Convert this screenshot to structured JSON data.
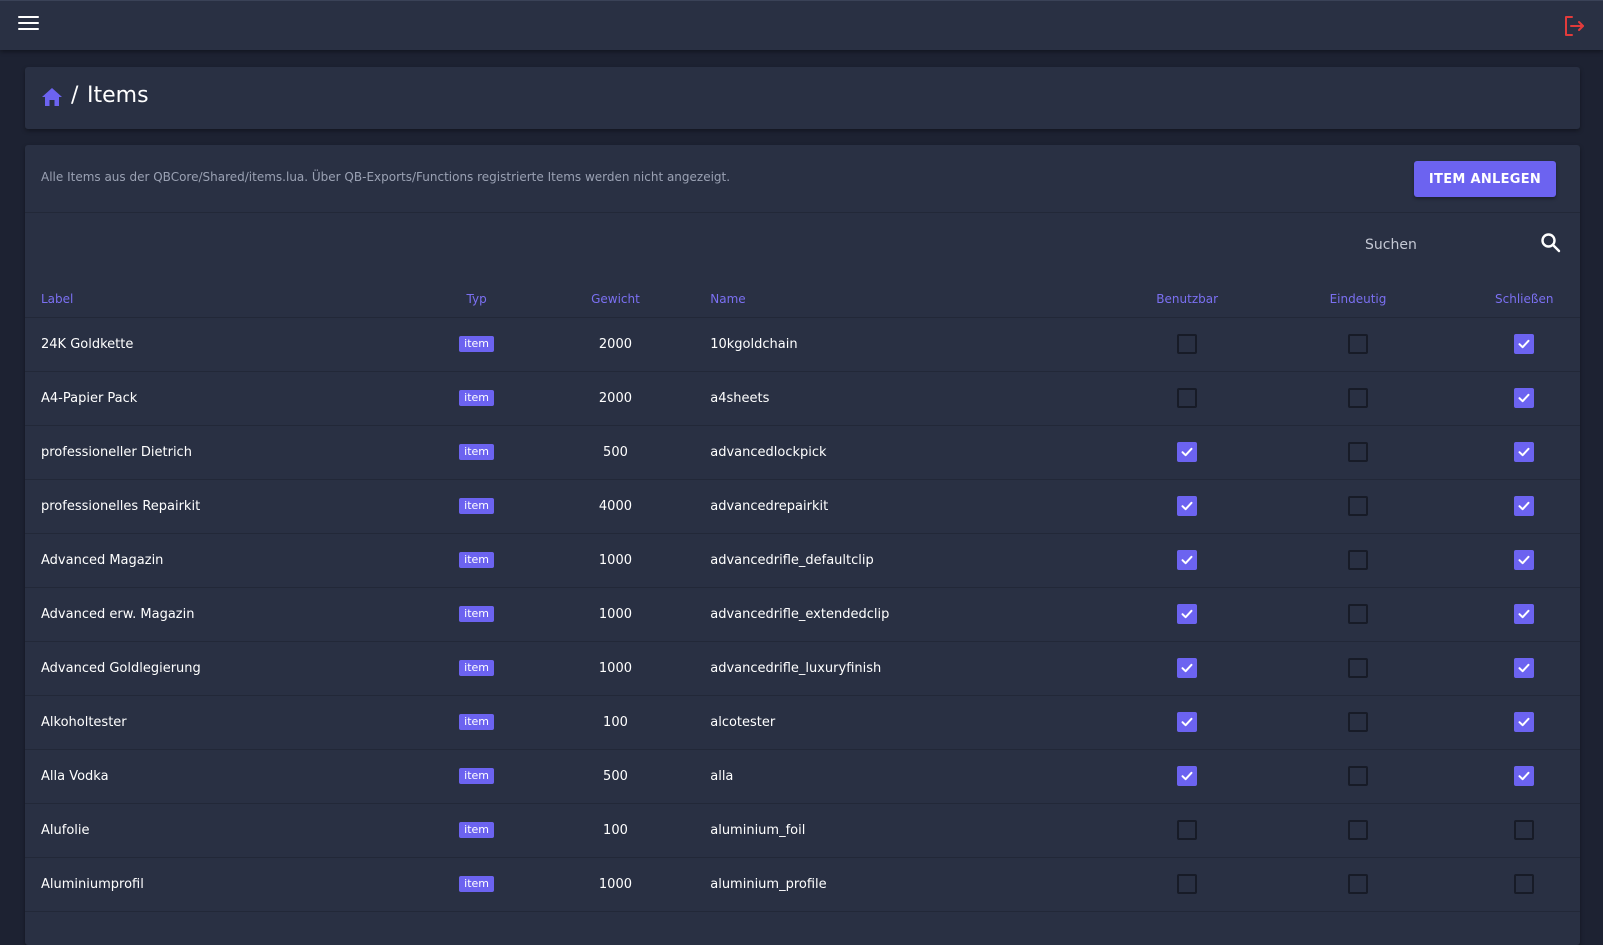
{
  "header": {
    "menu_icon": "hamburger-menu-icon",
    "logout_icon": "logout-icon",
    "accent_color": "#e23b3b"
  },
  "breadcrumb": {
    "home_icon": "home-icon",
    "separator": "/",
    "title": "Items"
  },
  "card": {
    "description": "Alle Items aus der QBCore/Shared/items.lua. Über QB-Exports/Functions registrierte Items werden nicht angezeigt.",
    "add_button_label": "ITEM ANLEGEN"
  },
  "search": {
    "placeholder": "Suchen",
    "value": ""
  },
  "colors": {
    "accent": "#6c63f0",
    "background": "#1d2232",
    "surface": "#293043"
  },
  "table": {
    "columns": [
      "Label",
      "Typ",
      "Gewicht",
      "Name",
      "Benutzbar",
      "Eindeutig",
      "Schließen"
    ],
    "rows": [
      {
        "label": "24K Goldkette",
        "typ": "item",
        "gewicht": "2000",
        "name": "10kgoldchain",
        "benutzbar": false,
        "eindeutig": false,
        "schliessen": true
      },
      {
        "label": "A4-Papier Pack",
        "typ": "item",
        "gewicht": "2000",
        "name": "a4sheets",
        "benutzbar": false,
        "eindeutig": false,
        "schliessen": true
      },
      {
        "label": "professioneller Dietrich",
        "typ": "item",
        "gewicht": "500",
        "name": "advancedlockpick",
        "benutzbar": true,
        "eindeutig": false,
        "schliessen": true
      },
      {
        "label": "professionelles Repairkit",
        "typ": "item",
        "gewicht": "4000",
        "name": "advancedrepairkit",
        "benutzbar": true,
        "eindeutig": false,
        "schliessen": true
      },
      {
        "label": "Advanced Magazin",
        "typ": "item",
        "gewicht": "1000",
        "name": "advancedrifle_defaultclip",
        "benutzbar": true,
        "eindeutig": false,
        "schliessen": true
      },
      {
        "label": "Advanced erw. Magazin",
        "typ": "item",
        "gewicht": "1000",
        "name": "advancedrifle_extendedclip",
        "benutzbar": true,
        "eindeutig": false,
        "schliessen": true
      },
      {
        "label": "Advanced Goldlegierung",
        "typ": "item",
        "gewicht": "1000",
        "name": "advancedrifle_luxuryfinish",
        "benutzbar": true,
        "eindeutig": false,
        "schliessen": true
      },
      {
        "label": "Alkoholtester",
        "typ": "item",
        "gewicht": "100",
        "name": "alcotester",
        "benutzbar": true,
        "eindeutig": false,
        "schliessen": true
      },
      {
        "label": "Alla Vodka",
        "typ": "item",
        "gewicht": "500",
        "name": "alla",
        "benutzbar": true,
        "eindeutig": false,
        "schliessen": true
      },
      {
        "label": "Alufolie",
        "typ": "item",
        "gewicht": "100",
        "name": "aluminium_foil",
        "benutzbar": false,
        "eindeutig": false,
        "schliessen": false
      },
      {
        "label": "Aluminiumprofil",
        "typ": "item",
        "gewicht": "1000",
        "name": "aluminium_profile",
        "benutzbar": false,
        "eindeutig": false,
        "schliessen": false
      }
    ]
  }
}
